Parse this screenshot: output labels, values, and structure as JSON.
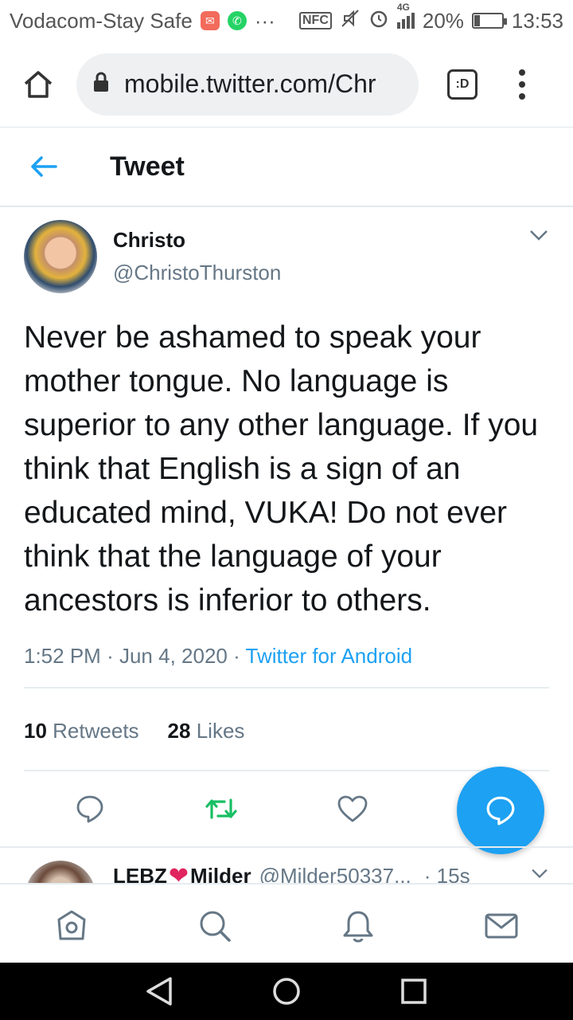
{
  "status_bar": {
    "carrier": "Vodacom-Stay Safe",
    "more": "···",
    "nfc": "NFC",
    "network": "4G",
    "battery": "20%",
    "battery_level": 0.2,
    "time": "13:53"
  },
  "browser": {
    "url": "mobile.twitter.com/Chr",
    "tab_label": ":D"
  },
  "header": {
    "title": "Tweet"
  },
  "tweet": {
    "author_name": "Christo",
    "author_handle": "@ChristoThurston",
    "text": "Never be ashamed to speak your mother tongue. No language is superior to any other language. If you think that English is a sign of an educated mind, VUKA! Do not ever think that the language of your ancestors is inferior to others.",
    "time": "1:52 PM",
    "date": "Jun 4, 2020",
    "separator": "·",
    "source": "Twitter for Android",
    "retweets_count": "10",
    "retweets_label": "Retweets",
    "likes_count": "28",
    "likes_label": "Likes"
  },
  "reply": {
    "name_part1": "LEBZ",
    "heart": "❤",
    "name_part2": "Milder",
    "handle": "@Milder50337...",
    "time": "· 15s"
  },
  "colors": {
    "accent": "#1da1f2",
    "retweet_green": "#17bf63",
    "muted": "#657786"
  }
}
